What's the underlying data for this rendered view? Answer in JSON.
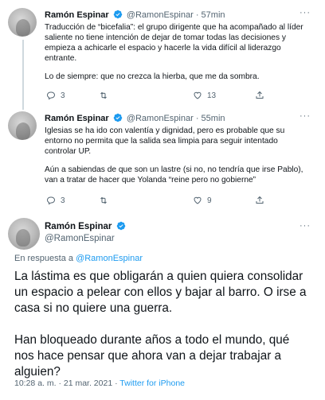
{
  "tweets": [
    {
      "name": "Ramón Espinar",
      "handle": "@RamonEspinar",
      "separator": "·",
      "time": "57min",
      "text": [
        "Traducción de “bicefalia”: el grupo dirigente que ha acompañado al líder saliente no tiene intención de dejar de tomar todas las decisiones y empieza a achicarle el espacio y hacerle la vida difícil al liderazgo entrante.",
        "Lo de siempre: que no crezca la hierba, que me da sombra."
      ],
      "replies": "3",
      "retweets": "",
      "likes": "13"
    },
    {
      "name": "Ramón Espinar",
      "handle": "@RamonEspinar",
      "separator": "·",
      "time": "55min",
      "text": [
        "Iglesias se ha ido con valentía y dignidad, pero es probable que su entorno no permita que la salida sea limpia para seguir intentado controlar UP.",
        "Aún a sabiendas de que son un lastre (si no, no tendría que irse Pablo), van a tratar de hacer que Yolanda “reine pero no gobierne”"
      ],
      "replies": "3",
      "retweets": "",
      "likes": "9"
    }
  ],
  "main": {
    "name": "Ramón Espinar",
    "handle": "@RamonEspinar",
    "replying_prefix": "En respuesta a ",
    "replying_to": "@RamonEspinar",
    "text": [
      "La lástima es que obligarán a quien quiera consolidar un espacio a pelear con ellos y bajar al barro. O irse a casa si no quiere una guerra.",
      "Han bloqueado durante años a todo el mundo, qué nos hace pensar que ahora van a dejar trabajar a alguien?"
    ],
    "timestamp": "10:28 a. m. · 21 mar. 2021 · ",
    "source": "Twitter for iPhone"
  },
  "icons": {
    "reply": "reply-icon",
    "retweet": "retweet-icon",
    "like": "like-icon",
    "share": "share-icon",
    "verified": "verified-badge-icon"
  },
  "colors": {
    "accent": "#1d9bf0",
    "muted": "#536471",
    "line": "#cfd9de"
  }
}
